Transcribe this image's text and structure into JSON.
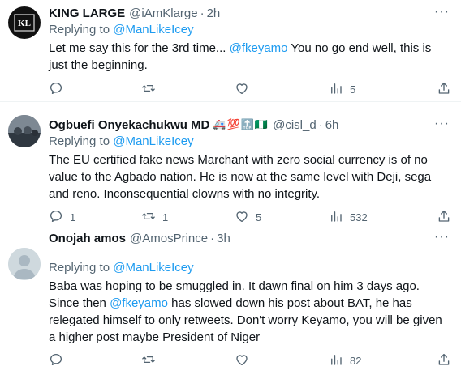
{
  "tweets": [
    {
      "avatar_text": "KL",
      "name": "KING LARGE",
      "emoji": "",
      "handle": "@iAmKlarge",
      "sep": "·",
      "time": "2h",
      "more": "···",
      "replying_prefix": "Replying to ",
      "replying_to": "@ManLikeIcey",
      "text_parts": [
        "Let me say this for the 3rd time... ",
        "@fkeyamo",
        " You no go end well, this is just the beginning."
      ],
      "replies": "",
      "retweets": "",
      "likes": "",
      "views": "5"
    },
    {
      "name": "Ogbuefi Onyekachukwu MD",
      "emoji": "🚑💯🔝🇳🇬",
      "handle": "@cisl_d",
      "sep": "·",
      "time": "6h",
      "more": "···",
      "replying_prefix": "Replying to ",
      "replying_to": "@ManLikeIcey",
      "text_parts": [
        "The EU certified fake news Marchant with zero social currency is of no value to the Agbado nation. He is now at the same level with Deji, sega and reno. Inconsequential clowns with no integrity."
      ],
      "replies": "1",
      "retweets": "1",
      "likes": "5",
      "views": "532"
    },
    {
      "name": "Onojah amos",
      "emoji": "",
      "handle": "@AmosPrince",
      "sep": "·",
      "time": "3h",
      "more": "···",
      "replying_prefix": "Replying to ",
      "replying_to": "@ManLikeIcey",
      "text_parts": [
        "Baba was hoping to be smuggled in. It dawn final on him 3 days ago. Since then ",
        "@fkeyamo",
        " has slowed down his post about BAT, he has relegated himself to only retweets. Don't worry Keyamo, you will be given a higher post maybe President of Niger"
      ],
      "replies": "",
      "retweets": "",
      "likes": "",
      "views": "82"
    }
  ],
  "icons": [
    "reply-icon",
    "retweet-icon",
    "like-icon",
    "views-icon",
    "share-icon"
  ],
  "colors": {
    "link": "#1d9bf0",
    "secondary": "#536471",
    "primary": "#0f1419",
    "divider": "#eff3f4"
  }
}
